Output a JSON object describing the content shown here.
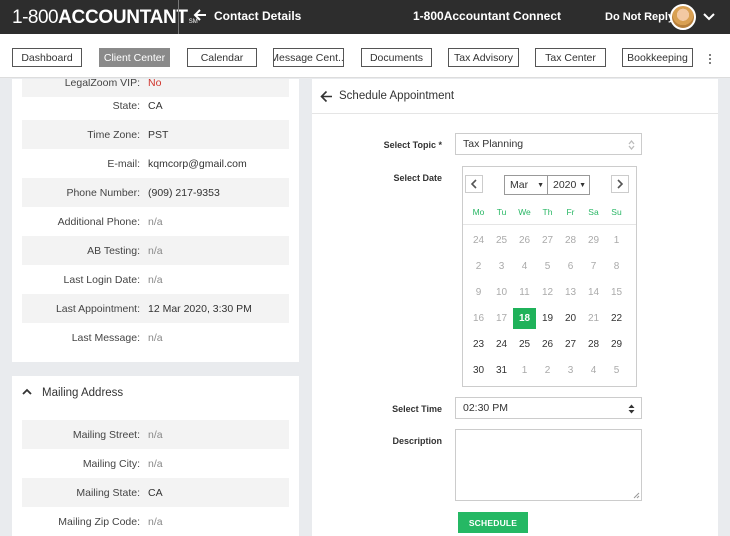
{
  "header": {
    "logo_num": "1-800",
    "logo_text": "ACCOUNTANT",
    "logo_tm": "SM",
    "contact_title": "Contact Details",
    "app_title": "1-800Accountant Connect",
    "user_name": "Do Not Reply"
  },
  "nav": {
    "items": [
      "Dashboard",
      "Client Center",
      "Calendar",
      "Message Cent...",
      "Documents",
      "Tax Advisory",
      "Tax Center",
      "Bookkeeping"
    ],
    "active": "Client Center"
  },
  "contact": {
    "rows": [
      {
        "label": "LegalZoom VIP:",
        "value": "No"
      },
      {
        "label": "State:",
        "value": "CA"
      },
      {
        "label": "Time Zone:",
        "value": "PST"
      },
      {
        "label": "E-mail:",
        "value": "kqmcorp@gmail.com"
      },
      {
        "label": "Phone Number:",
        "value": "(909) 217-9353"
      },
      {
        "label": "Additional Phone:",
        "value": "n/a"
      },
      {
        "label": "AB Testing:",
        "value": "n/a"
      },
      {
        "label": "Last Login Date:",
        "value": "n/a"
      },
      {
        "label": "Last Appointment:",
        "value": "12 Mar 2020, 3:30 PM"
      },
      {
        "label": "Last Message:",
        "value": "n/a"
      }
    ]
  },
  "mailing": {
    "title": "Mailing Address",
    "rows": [
      {
        "label": "Mailing Street:",
        "value": "n/a"
      },
      {
        "label": "Mailing City:",
        "value": "n/a"
      },
      {
        "label": "Mailing State:",
        "value": "CA"
      },
      {
        "label": "Mailing Zip Code:",
        "value": "n/a"
      }
    ]
  },
  "schedule": {
    "title": "Schedule Appointment",
    "topic_label": "Select Topic *",
    "topic_value": "Tax Planning",
    "date_label": "Select Date",
    "month": "Mar",
    "year": "2020",
    "weekdays": [
      "Mo",
      "Tu",
      "We",
      "Th",
      "Fr",
      "Sa",
      "Su"
    ],
    "days": [
      [
        "24",
        "25",
        "26",
        "27",
        "28",
        "29",
        "1"
      ],
      [
        "2",
        "3",
        "4",
        "5",
        "6",
        "7",
        "8"
      ],
      [
        "9",
        "10",
        "11",
        "12",
        "13",
        "14",
        "15"
      ],
      [
        "16",
        "17",
        "18",
        "19",
        "20",
        "21",
        "22"
      ],
      [
        "23",
        "24",
        "25",
        "26",
        "27",
        "28",
        "29"
      ],
      [
        "30",
        "31",
        "1",
        "2",
        "3",
        "4",
        "5"
      ]
    ],
    "selected_day": "18",
    "time_label": "Select Time",
    "time_value": "02:30 PM",
    "description_label": "Description",
    "button_label": "SCHEDULE"
  },
  "colors": {
    "accent_green": "#25b864",
    "topbar": "#2d2d2d",
    "value_red": "#d0342c"
  }
}
